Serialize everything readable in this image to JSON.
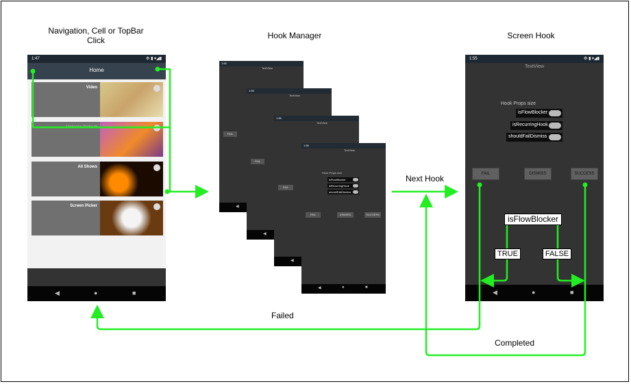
{
  "headings": {
    "left_line1": "Navigation, Cell or TopBar",
    "left_line2": "Click",
    "middle": "Hook Manager",
    "right": "Screen Hook"
  },
  "flow_labels": {
    "next_hook": "Next Hook",
    "failed": "Failed",
    "completed": "Completed",
    "true": "TRUE",
    "false": "FALSE",
    "is_flow_blocker": "isFlowBlocker"
  },
  "left_phone": {
    "time": "1:47",
    "status_icons": "⚙ ▮  ▾◢▮",
    "title": "Home",
    "cells": [
      {
        "label": "Video"
      },
      {
        "label": "Unlocks Default"
      },
      {
        "label": "All Shows"
      },
      {
        "label": "Screen Picker"
      }
    ]
  },
  "stack_phone": {
    "time": "1:55",
    "textview": "TextView",
    "hook_props": "Hook Props size",
    "toggles": [
      "isFlowBlocker",
      "isRecurringHook",
      "shouldFailDismiss"
    ],
    "buttons": [
      "FAIL",
      "DISMISS",
      "SUCCESS"
    ]
  },
  "right_phone": {
    "time": "1:55",
    "textview": "TextView",
    "hook_props": "Hook Props size",
    "toggles": [
      "isFlowBlocker",
      "isRecurringHook",
      "shouldFailDismiss"
    ],
    "buttons": [
      "FAIL",
      "DISMISS",
      "SUCCESS"
    ]
  },
  "nav_icons": {
    "back": "◀",
    "home": "●",
    "recent": "■"
  },
  "colors": {
    "flow_arrow": "#22ee22",
    "phone_bg": "#333333",
    "status_bar": "#222a33"
  }
}
